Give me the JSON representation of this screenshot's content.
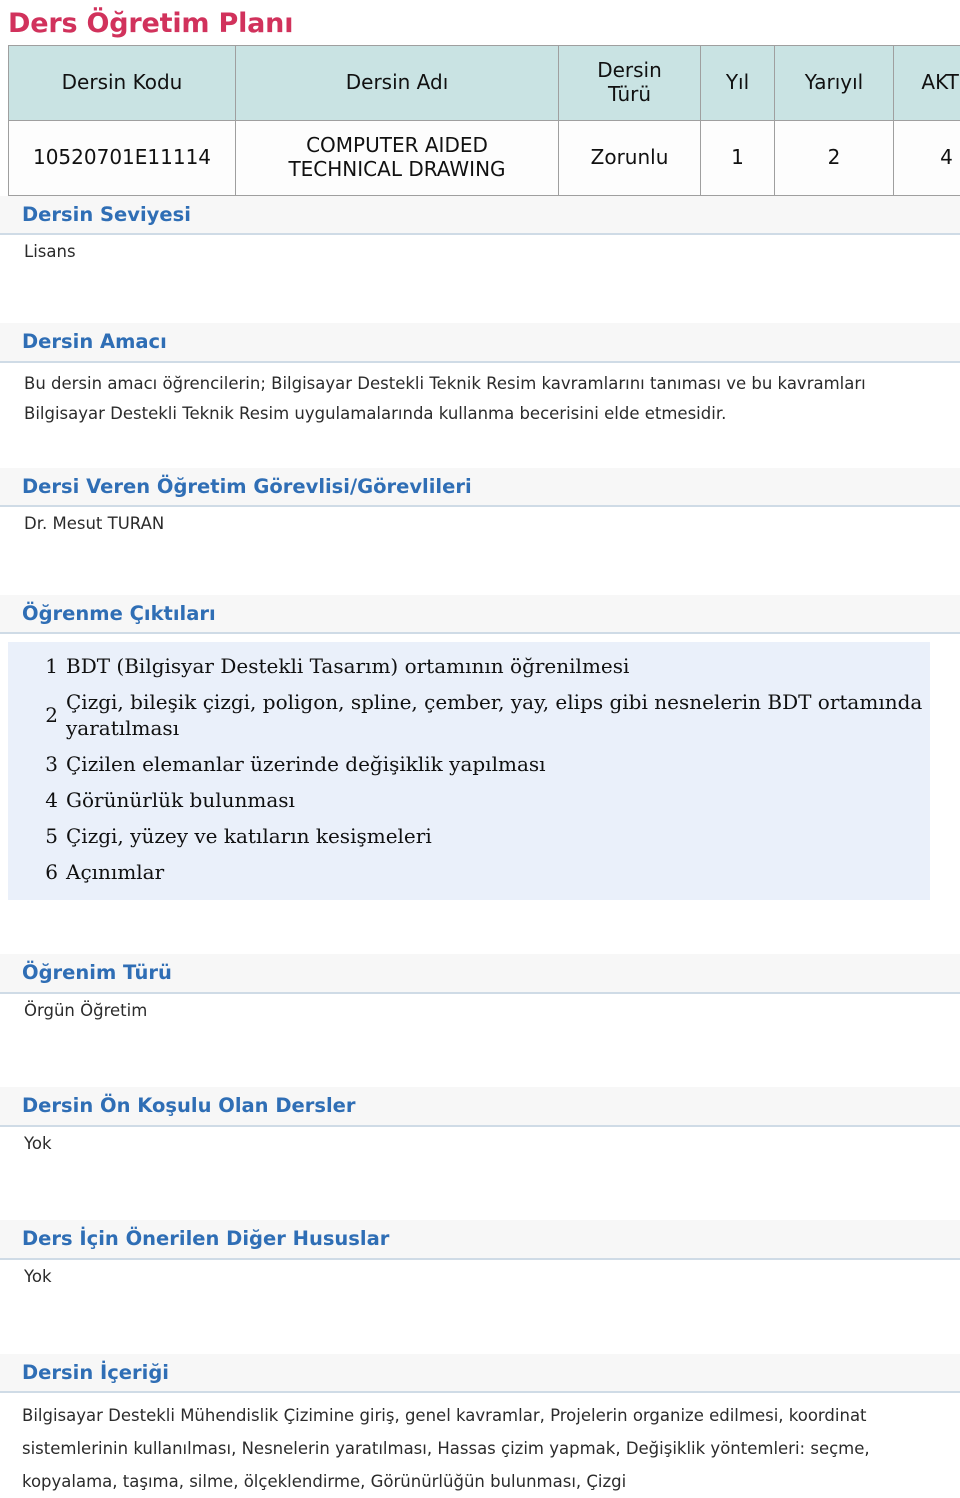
{
  "page": {
    "title": "Ders Öğretim Planı"
  },
  "summary_table": {
    "headers": [
      "Dersin Kodu",
      "Dersin Adı",
      "Dersin Türü",
      "Yıl",
      "Yarıyıl",
      "AKTS"
    ],
    "header_type_line1": "Dersin",
    "header_type_line2": "Türü",
    "row": {
      "code": "10520701E11114",
      "name_line1": "COMPUTER AIDED",
      "name_line2": "TECHNICAL DRAWING",
      "type": "Zorunlu",
      "year": "1",
      "term": "2",
      "akts": "4"
    }
  },
  "sections": {
    "level": {
      "heading": "Dersin Seviyesi",
      "body": "Lisans"
    },
    "aim": {
      "heading": "Dersin Amacı",
      "body": "Bu dersin amacı öğrencilerin; Bilgisayar Destekli Teknik Resim kavramlarını tanıması ve bu kavramları Bilgisayar Destekli Teknik Resim uygulamalarında kullanma becerisini elde etmesidir."
    },
    "instructors": {
      "heading": "Dersi Veren Öğretim Görevlisi/Görevlileri",
      "body": "Dr. Mesut TURAN"
    },
    "outcomes": {
      "heading": "Öğrenme Çıktıları",
      "items": [
        {
          "num": "1",
          "text": "BDT (Bilgisyar Destekli Tasarım) ortamının öğrenilmesi"
        },
        {
          "num": "2",
          "text": "Çizgi, bileşik çizgi, poligon, spline, çember, yay, elips gibi nesnelerin BDT ortamında yaratılması"
        },
        {
          "num": "3",
          "text": "Çizilen elemanlar üzerinde değişiklik yapılması"
        },
        {
          "num": "4",
          "text": "Görünürlük bulunması"
        },
        {
          "num": "5",
          "text": "Çizgi, yüzey ve katıların kesişmeleri"
        },
        {
          "num": "6",
          "text": "Açınımlar"
        }
      ]
    },
    "education_type": {
      "heading": "Öğrenim Türü",
      "body": "Örgün Öğretim"
    },
    "prerequisites": {
      "heading": "Dersin Ön Koşulu Olan Dersler",
      "body": "Yok"
    },
    "recommendations": {
      "heading": "Ders İçin Önerilen Diğer Hususlar",
      "body": "Yok"
    },
    "content": {
      "heading": "Dersin İçeriği",
      "body": "Bilgisayar Destekli Mühendislik Çizimine giriş, genel kavramlar, Projelerin organize edilmesi, koordinat sistemlerinin kullanılması, Nesnelerin yaratılması, Hassas çizim yapmak, Değişiklik yöntemleri: seçme, kopyalama, taşıma, silme, ölçeklendirme, Görünürlüğün bulunması, Çizgi"
    }
  },
  "colors": {
    "title": "#d1325c",
    "section_heading": "#2f6eb5",
    "table_header_bg": "#c9e3e3",
    "outcomes_bg": "#eaf0fa",
    "section_header_bg": "#f7f7f7",
    "section_header_border": "#cfdbe6"
  }
}
